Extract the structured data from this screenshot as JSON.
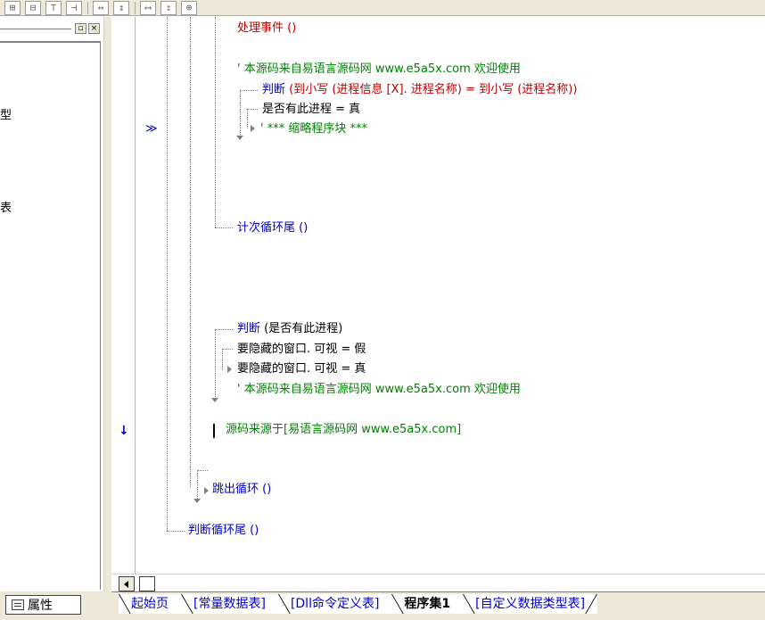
{
  "toolbar": {
    "icons": [
      "align-left-icon",
      "align-center-icon",
      "align-top-icon",
      "align-right-icon",
      "space-horizontal-icon",
      "space-vertical-icon",
      "same-width-icon",
      "same-height-icon",
      "same-size-icon"
    ]
  },
  "left_panel": {
    "fragments": [
      "型",
      "表"
    ],
    "close_glyph": "×",
    "restore_glyph": "▫",
    "bottom_tab": "属性"
  },
  "code": {
    "l_event": "处理事件 ()",
    "l_comment1": "' 本源码来自易语言源码网 www.e5a5x.com  欢迎使用",
    "l_if1_kw": "判断",
    "l_if1_a": " (到小写 (进程信息 [X]. 进程名称) = 到小写 (进程名称))",
    "l_assign1": "是否有此进程  =  真",
    "l_omitted": "' *** 缩略程序块 ***",
    "l_loop_end": "计次循环尾 ()",
    "l_if2_kw": "判断",
    "l_if2_a": " (是否有此进程)",
    "l_assign2": "要隐藏的窗口. 可视  =  假",
    "l_assign3": "要隐藏的窗口. 可视  =  真",
    "l_comment2": "' 本源码来自易语言源码网 www.e5a5x.com  欢迎使用",
    "l_source": "源码来源于[易语言源码网 www.e5a5x.com]",
    "l_break": "跳出循环 ()",
    "l_loop_end2": "判断循环尾 ()",
    "gutter_mark": "≫",
    "gutter_arrow": "↓"
  },
  "tabs": [
    {
      "label": "起始页",
      "active": false
    },
    {
      "label": "[常量数据表]",
      "active": false
    },
    {
      "label": "[Dll命令定义表]",
      "active": false
    },
    {
      "label": "程序集1",
      "active": true
    },
    {
      "label": "[自定义数据类型表]",
      "active": false
    }
  ]
}
